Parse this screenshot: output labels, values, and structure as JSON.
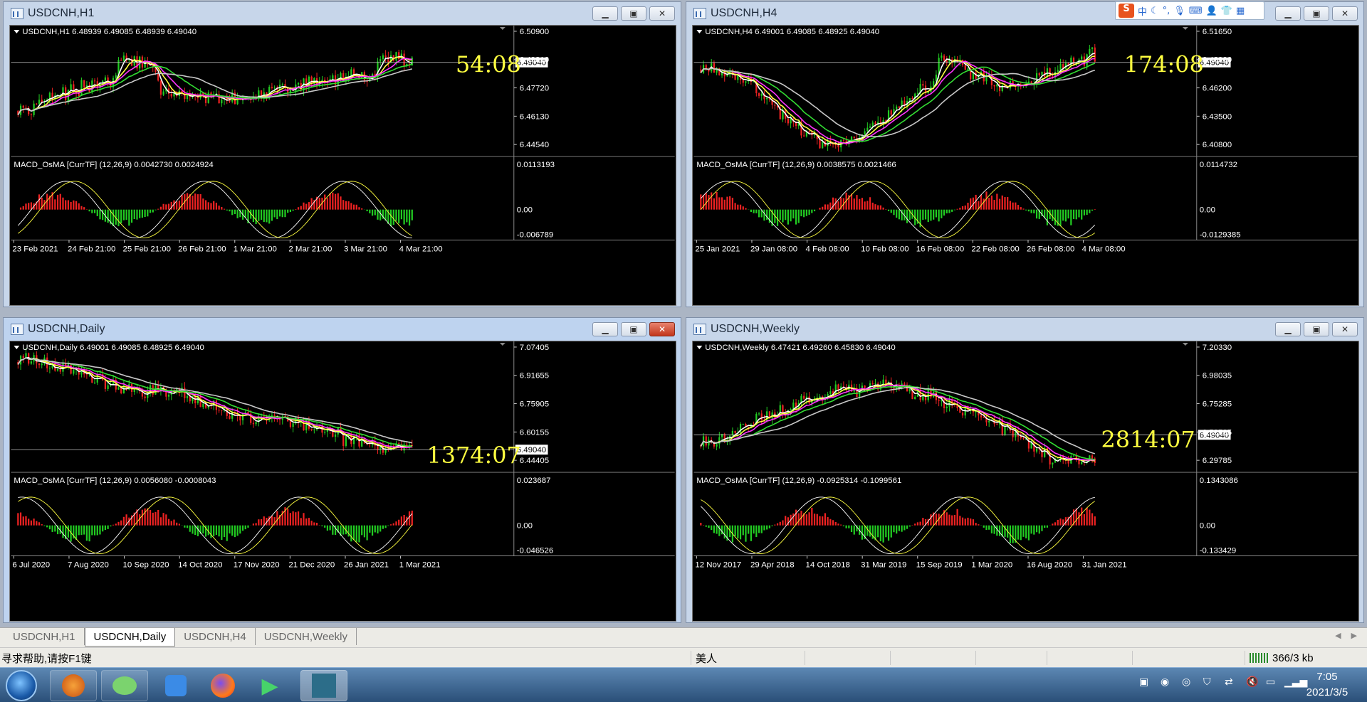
{
  "windows": [
    {
      "id": "h1",
      "title": "USDCNH,H1",
      "ohlc_label": "USDCNH,H1  6.48939 6.49085 6.48939 6.49040",
      "price_ticks": [
        "6.50900",
        "6.49310",
        "6.47720",
        "6.46130",
        "6.44540"
      ],
      "price_current": "6.49040",
      "macd_label": "MACD_OsMA [CurrTF] (12,26,9) 0.0042730 0.0024924",
      "macd_ticks": [
        "0.0113193",
        "0.00",
        "-0.006789"
      ],
      "time_ticks": [
        "23 Feb 2021",
        "24 Feb 21:00",
        "25 Feb 21:00",
        "26 Feb 21:00",
        "1 Mar 21:00",
        "2 Mar 21:00",
        "3 Mar 21:00",
        "4 Mar 21:00"
      ],
      "countdown": "54:08"
    },
    {
      "id": "h4",
      "title": "USDCNH,H4",
      "ohlc_label": "USDCNH,H4  6.49001 6.49085 6.48925 6.49040",
      "price_ticks": [
        "6.51650",
        "6.48900",
        "6.46200",
        "6.43500",
        "6.40800"
      ],
      "price_current": "6.49040",
      "macd_label": "MACD_OsMA [CurrTF] (12,26,9) 0.0038575 0.0021466",
      "macd_ticks": [
        "0.0114732",
        "0.00",
        "-0.0129385"
      ],
      "time_ticks": [
        "25 Jan 2021",
        "29 Jan 08:00",
        "4 Feb 08:00",
        "10 Feb 08:00",
        "16 Feb 08:00",
        "22 Feb 08:00",
        "26 Feb 08:00",
        "4 Mar 08:00"
      ],
      "countdown": "174:08"
    },
    {
      "id": "daily",
      "title": "USDCNH,Daily",
      "ohlc_label": "USDCNH,Daily  6.49001 6.49085 6.48925 6.49040",
      "price_ticks": [
        "7.07405",
        "6.91655",
        "6.75905",
        "6.60155",
        "6.44405"
      ],
      "price_current": "6.49040",
      "macd_label": "MACD_OsMA [CurrTF] (12,26,9) 0.0056080 -0.0008043",
      "macd_ticks": [
        "0.023687",
        "0.00",
        "-0.046526"
      ],
      "time_ticks": [
        "6 Jul 2020",
        "7 Aug 2020",
        "10 Sep 2020",
        "14 Oct 2020",
        "17 Nov 2020",
        "21 Dec 2020",
        "26 Jan 2021",
        "1 Mar 2021"
      ],
      "countdown": "1374:07"
    },
    {
      "id": "weekly",
      "title": "USDCNH,Weekly",
      "ohlc_label": "USDCNH,Weekly  6.47421 6.49260 6.45830 6.49040",
      "price_ticks": [
        "7.20330",
        "6.98035",
        "6.75285",
        "6.52535",
        "6.29785"
      ],
      "price_current": "6.49040",
      "macd_label": "MACD_OsMA [CurrTF] (12,26,9) -0.0925314 -0.1099561",
      "macd_ticks": [
        "0.1343086",
        "0.00",
        "-0.133429"
      ],
      "time_ticks": [
        "12 Nov 2017",
        "29 Apr 2018",
        "14 Oct 2018",
        "31 Mar 2019",
        "15 Sep 2019",
        "1 Mar 2020",
        "16 Aug 2020",
        "31 Jan 2021"
      ],
      "countdown": "2814:07"
    }
  ],
  "tabs": [
    "USDCNH,H1",
    "USDCNH,Daily",
    "USDCNH,H4",
    "USDCNH,Weekly"
  ],
  "active_tab": "USDCNH,Daily",
  "status": {
    "help": "寻求帮助,请按F1键",
    "profile": "美人",
    "traffic": "366/3 kb"
  },
  "taskbar": {
    "time": "7:05",
    "date": "2021/3/5",
    "apps": [
      "start-orb",
      "app-fox",
      "wechat",
      "notes",
      "firefox",
      "video-player",
      "trading-terminal"
    ]
  },
  "ime": {
    "mode": "中"
  },
  "colors": {
    "bull": "#22cc22",
    "bear": "#ee2222",
    "ma_fast": "#ffffff",
    "ma_yellow": "#ffff40",
    "ma_magenta": "#ff33ff",
    "ma_green": "#33dd33",
    "ma_slow": "#c8c8c8",
    "countdown": "#ffff40"
  }
}
